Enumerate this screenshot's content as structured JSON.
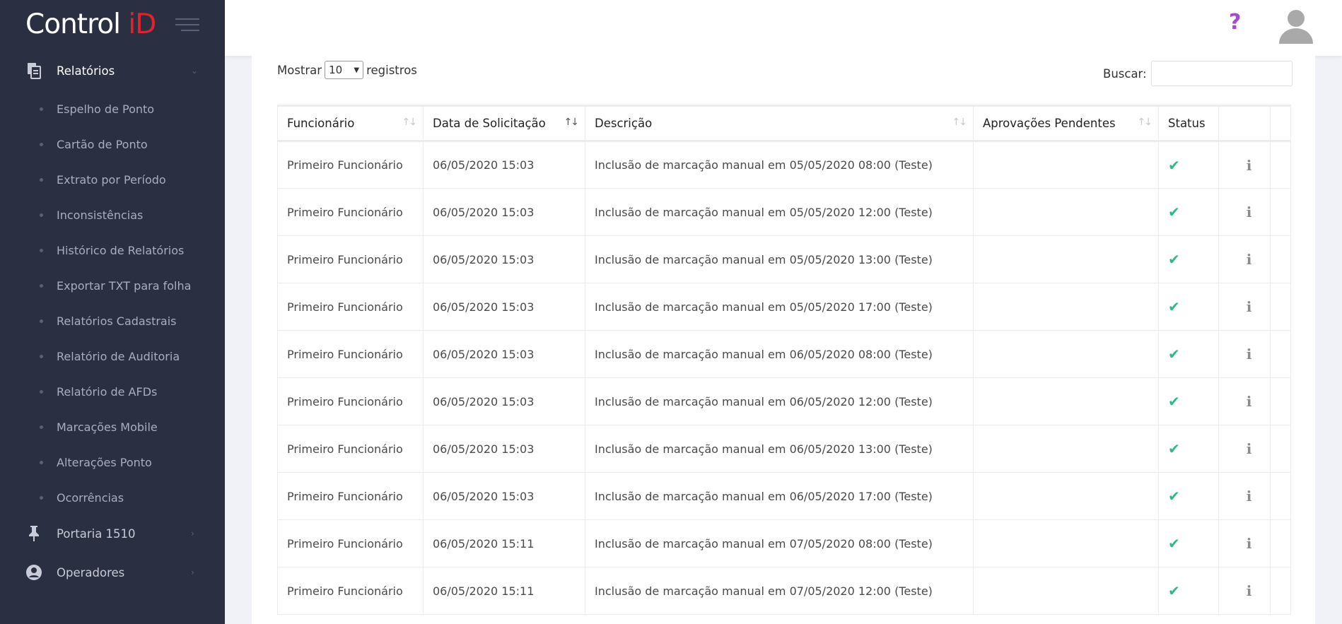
{
  "brand": {
    "name": "Control ",
    "accent": "iD",
    "accent_color": "#e8202a"
  },
  "sidebar": {
    "sections": [
      {
        "label": "Relatórios",
        "icon": "copy-documents-icon",
        "expanded": true
      },
      {
        "label": "Portaria 1510",
        "icon": "pushpin-icon",
        "expanded": false
      },
      {
        "label": "Operadores",
        "icon": "user-circle-icon",
        "expanded": false
      }
    ],
    "report_items": [
      {
        "label": "Espelho de Ponto"
      },
      {
        "label": "Cartão de Ponto"
      },
      {
        "label": "Extrato por Período"
      },
      {
        "label": "Inconsistências"
      },
      {
        "label": "Histórico de Relatórios"
      },
      {
        "label": "Exportar TXT para folha"
      },
      {
        "label": "Relatórios Cadastrais"
      },
      {
        "label": "Relatório de Auditoria"
      },
      {
        "label": "Relatório de AFDs"
      },
      {
        "label": "Marcações Mobile"
      },
      {
        "label": "Alterações Ponto"
      },
      {
        "label": "Ocorrências"
      }
    ]
  },
  "topbar": {
    "help_symbol": "?",
    "help_color": "#a24bd1"
  },
  "table_controls": {
    "show_label": "Mostrar",
    "page_length": "10",
    "records_label": "registros",
    "search_label": "Buscar:",
    "search_value": ""
  },
  "table": {
    "columns": [
      {
        "label": "Funcionário",
        "sort": "none"
      },
      {
        "label": "Data de Solicitação",
        "sort": "active"
      },
      {
        "label": "Descrição",
        "sort": "none"
      },
      {
        "label": "Aprovações Pendentes",
        "sort": "none"
      },
      {
        "label": "Status"
      },
      {
        "label": ""
      },
      {
        "label": ""
      }
    ],
    "rows": [
      {
        "employee": "Primeiro Funcionário",
        "date": "06/05/2020 15:03",
        "description": "Inclusão de marcação manual em 05/05/2020 08:00 (Teste)",
        "pending": "",
        "status": "approved"
      },
      {
        "employee": "Primeiro Funcionário",
        "date": "06/05/2020 15:03",
        "description": "Inclusão de marcação manual em 05/05/2020 12:00 (Teste)",
        "pending": "",
        "status": "approved"
      },
      {
        "employee": "Primeiro Funcionário",
        "date": "06/05/2020 15:03",
        "description": "Inclusão de marcação manual em 05/05/2020 13:00 (Teste)",
        "pending": "",
        "status": "approved"
      },
      {
        "employee": "Primeiro Funcionário",
        "date": "06/05/2020 15:03",
        "description": "Inclusão de marcação manual em 05/05/2020 17:00 (Teste)",
        "pending": "",
        "status": "approved"
      },
      {
        "employee": "Primeiro Funcionário",
        "date": "06/05/2020 15:03",
        "description": "Inclusão de marcação manual em 06/05/2020 08:00 (Teste)",
        "pending": "",
        "status": "approved"
      },
      {
        "employee": "Primeiro Funcionário",
        "date": "06/05/2020 15:03",
        "description": "Inclusão de marcação manual em 06/05/2020 12:00 (Teste)",
        "pending": "",
        "status": "approved"
      },
      {
        "employee": "Primeiro Funcionário",
        "date": "06/05/2020 15:03",
        "description": "Inclusão de marcação manual em 06/05/2020 13:00 (Teste)",
        "pending": "",
        "status": "approved"
      },
      {
        "employee": "Primeiro Funcionário",
        "date": "06/05/2020 15:03",
        "description": "Inclusão de marcação manual em 06/05/2020 17:00 (Teste)",
        "pending": "",
        "status": "approved"
      },
      {
        "employee": "Primeiro Funcionário",
        "date": "06/05/2020 15:11",
        "description": "Inclusão de marcação manual em 07/05/2020 08:00 (Teste)",
        "pending": "",
        "status": "approved"
      },
      {
        "employee": "Primeiro Funcionário",
        "date": "06/05/2020 15:11",
        "description": "Inclusão de marcação manual em 07/05/2020 12:00 (Teste)",
        "pending": "",
        "status": "approved"
      }
    ],
    "status_color": "#2fb98a",
    "status_symbol": "✔",
    "info_symbol": "i"
  }
}
